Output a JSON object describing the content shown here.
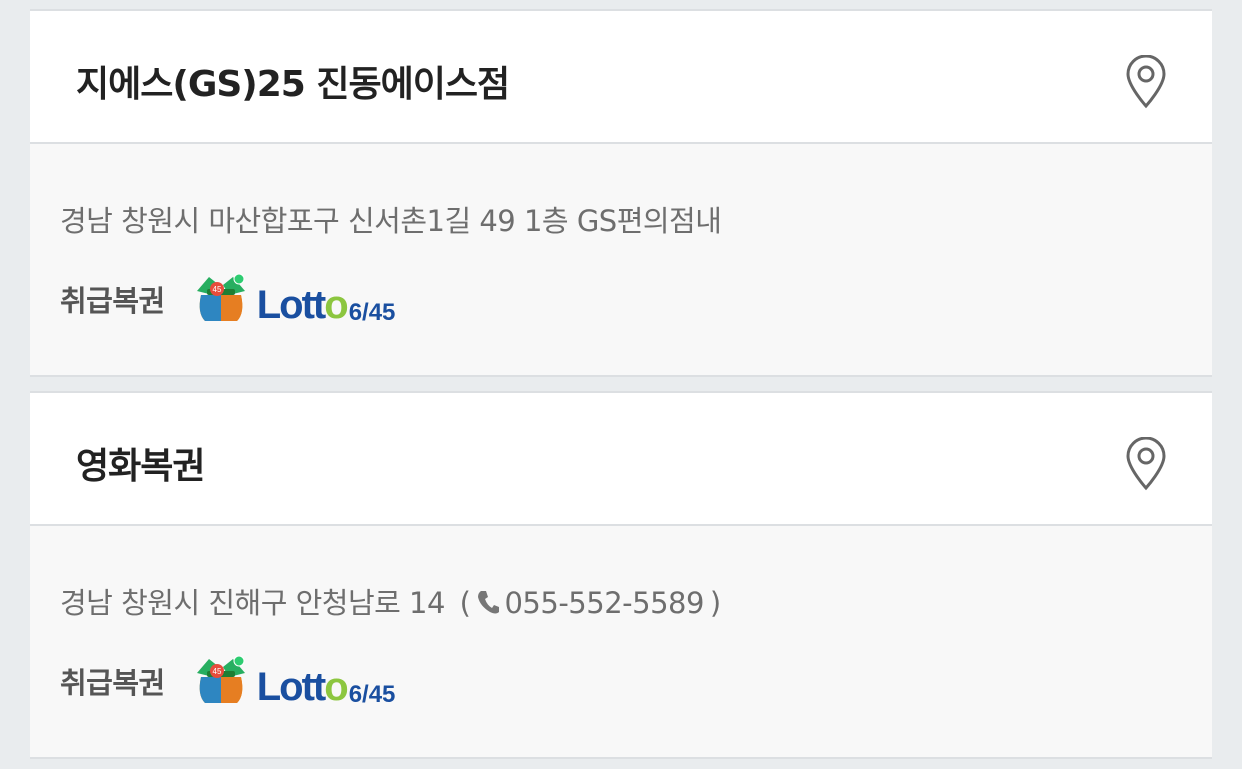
{
  "stores": [
    {
      "name": "지에스(GS)25 진동에이스점",
      "address": "경남 창원시 마산합포구 신서촌1길 49 1층 GS편의점내",
      "phone": null,
      "lotto_label": "취급복권",
      "lotto_word_a": "Lott",
      "lotto_word_b": "o",
      "lotto_num": "6/45",
      "bag_badge": "45"
    },
    {
      "name": "영화복권",
      "address": "경남 창원시 진해구 안청남로 14",
      "phone_open": "(",
      "phone": "055-552-5589",
      "phone_close": ")",
      "lotto_label": "취급복권",
      "lotto_word_a": "Lott",
      "lotto_word_b": "o",
      "lotto_num": "6/45",
      "bag_badge": "45"
    }
  ],
  "icons": {
    "map_pin": "map-pin-icon",
    "phone": "phone-icon",
    "lotto_logo": "lotto-bag-icon"
  },
  "colors": {
    "background": "#e9ecee",
    "card": "#ffffff",
    "card_body": "#f8f8f8",
    "lotto_blue": "#1a4fa0",
    "lotto_green": "#8cc63f"
  }
}
